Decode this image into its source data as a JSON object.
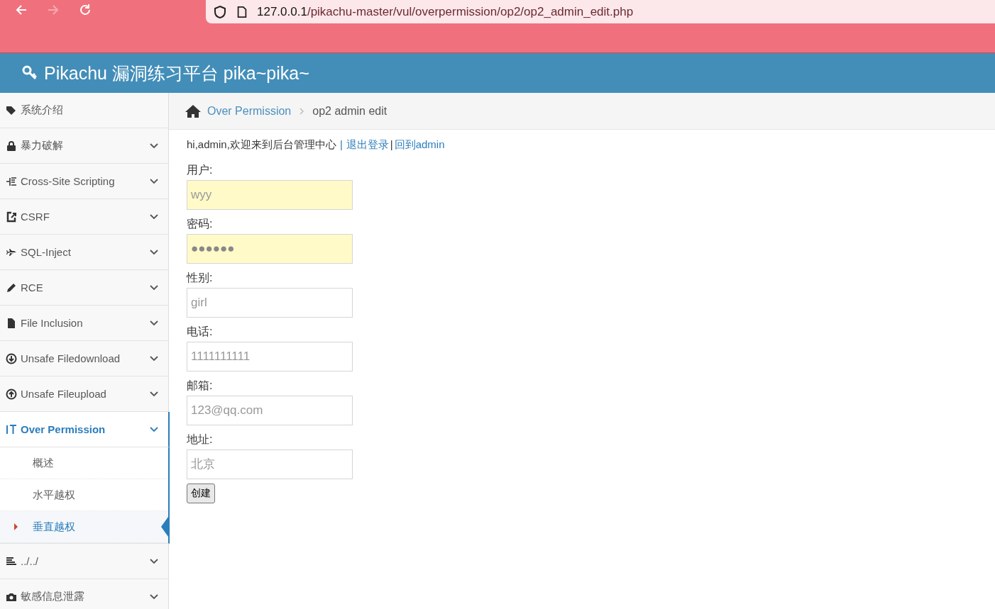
{
  "browser": {
    "back_disabled": false,
    "forward_disabled": true,
    "url_host": "127.0.0.1",
    "url_path": "/pikachu-master/vul/overpermission/op2/op2_admin_edit.php"
  },
  "header": {
    "title": "Pikachu 漏洞练习平台 pika~pika~"
  },
  "sidebar": {
    "items": [
      {
        "label": "系统介绍",
        "kind": "link",
        "expanded": false
      },
      {
        "label": "暴力破解",
        "kind": "menu",
        "expanded": false
      },
      {
        "label": "Cross-Site Scripting",
        "kind": "menu",
        "expanded": false
      },
      {
        "label": "CSRF",
        "kind": "menu",
        "expanded": false
      },
      {
        "label": "SQL-Inject",
        "kind": "menu",
        "expanded": false
      },
      {
        "label": "RCE",
        "kind": "menu",
        "expanded": false
      },
      {
        "label": "File Inclusion",
        "kind": "menu",
        "expanded": false
      },
      {
        "label": "Unsafe Filedownload",
        "kind": "menu",
        "expanded": false
      },
      {
        "label": "Unsafe Fileupload",
        "kind": "menu",
        "expanded": false
      },
      {
        "label": "Over Permission",
        "kind": "menu",
        "expanded": true,
        "children": [
          {
            "label": "概述",
            "selected": false
          },
          {
            "label": "水平越权",
            "selected": false
          },
          {
            "label": "垂直越权",
            "selected": true
          }
        ]
      },
      {
        "label": "../../",
        "kind": "menu",
        "expanded": false
      },
      {
        "label": "敏感信息泄露",
        "kind": "menu",
        "expanded": false
      }
    ]
  },
  "breadcrumb": {
    "link": "Over Permission",
    "current": "op2 admin edit"
  },
  "welcome": {
    "text": "hi,admin,欢迎来到后台管理中心",
    "separator": "|",
    "logout": "退出登录",
    "divider": "|",
    "back": "回到admin"
  },
  "form": {
    "fields": [
      {
        "label": "用户:",
        "placeholder": "wyy",
        "autofilled": true
      },
      {
        "label": "密码:",
        "value": "●●●●●●",
        "autofilled": true
      },
      {
        "label": "性别:",
        "placeholder": "girl",
        "autofilled": false
      },
      {
        "label": "电话:",
        "placeholder": "1111111111",
        "autofilled": false
      },
      {
        "label": "邮箱:",
        "placeholder": "123@qq.com",
        "autofilled": false
      },
      {
        "label": "地址:",
        "placeholder": "北京",
        "autofilled": false
      }
    ],
    "submit": "创建"
  }
}
